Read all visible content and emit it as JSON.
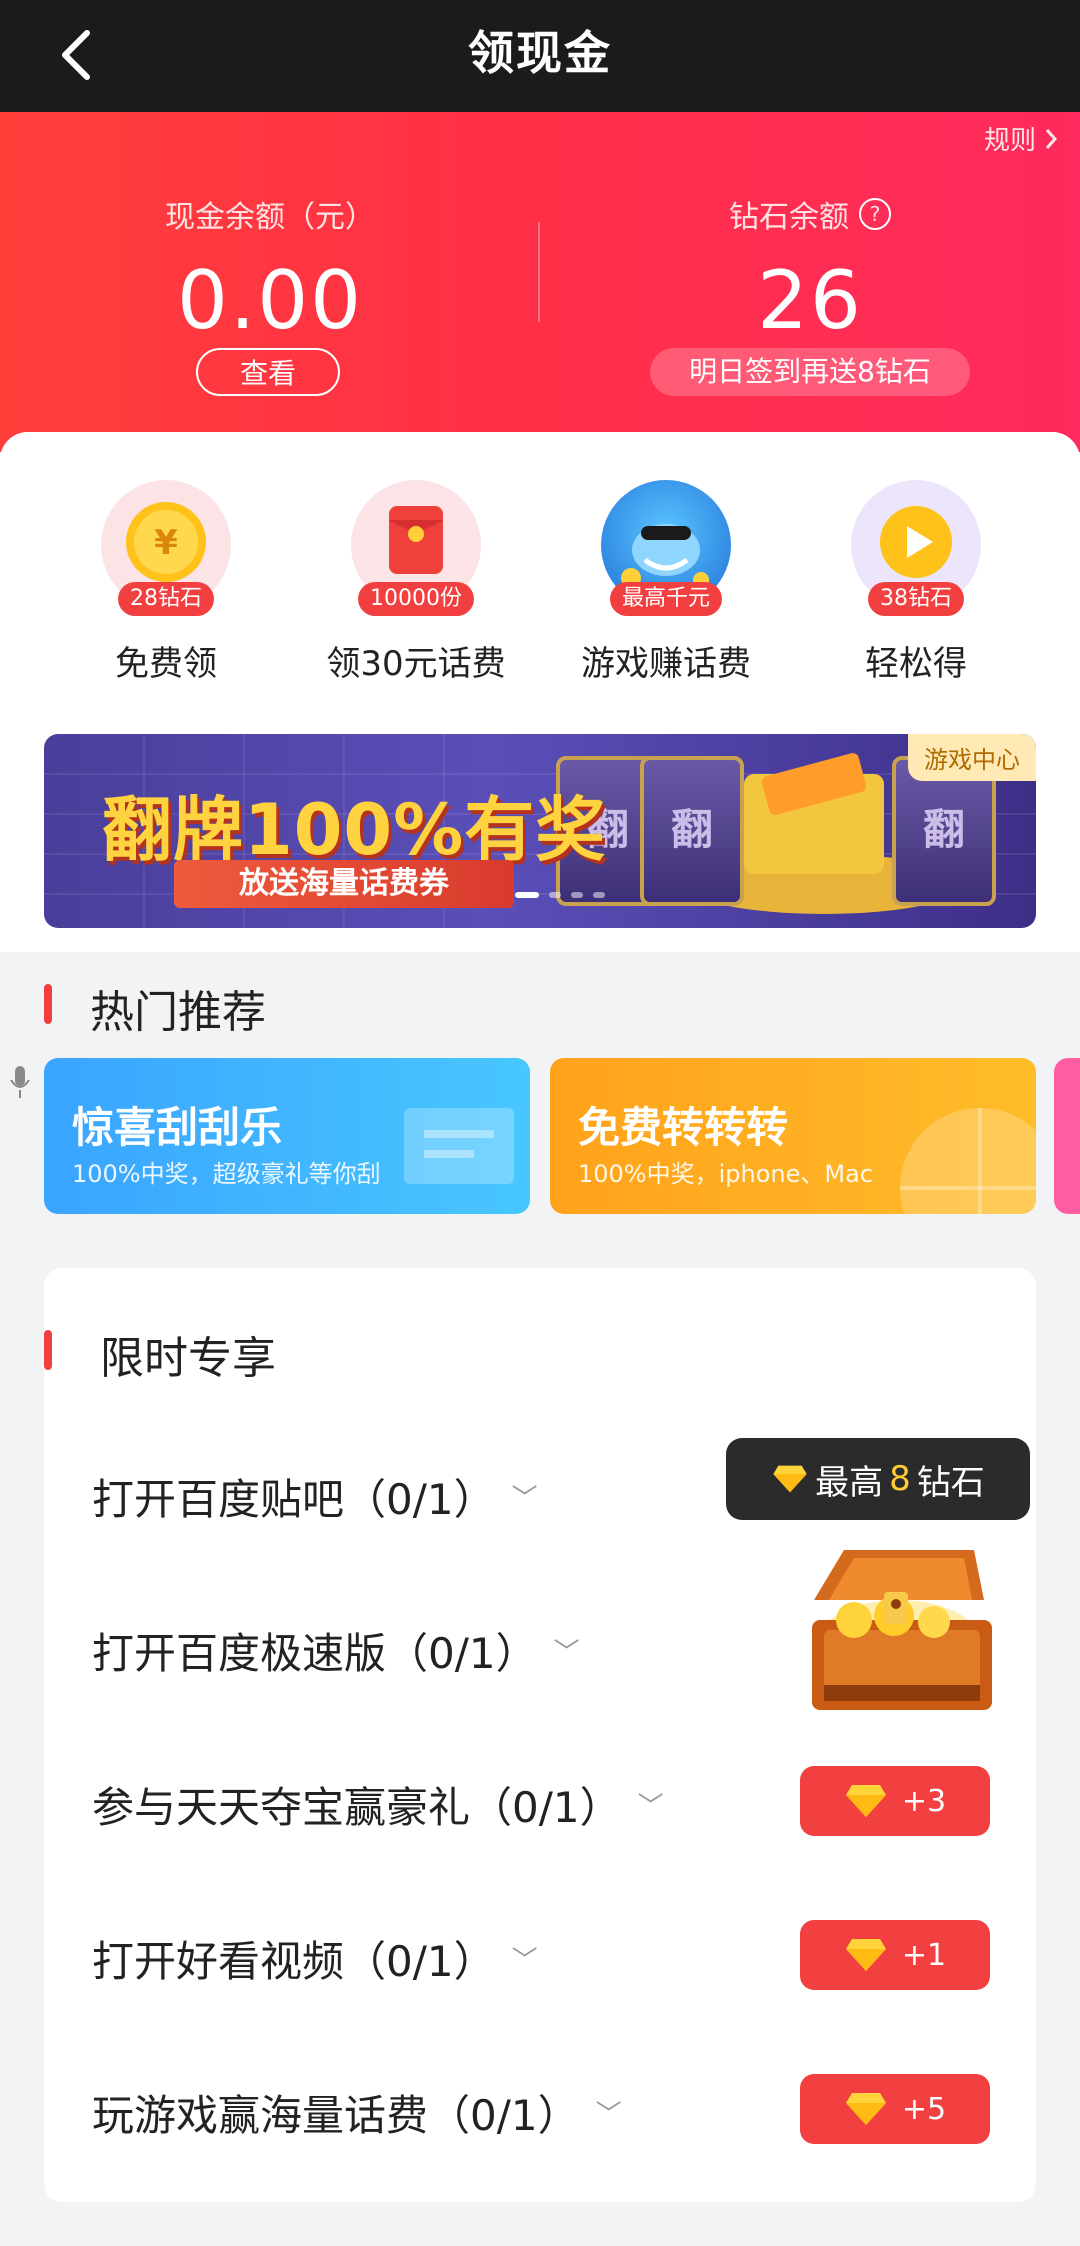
{
  "nav": {
    "title": "领现金"
  },
  "hero": {
    "rules": "规则",
    "cash_label": "现金余额（元）",
    "cash_value": "0.00",
    "view_label": "查看",
    "diamond_label": "钻石余额",
    "diamond_value": "26",
    "tomorrow_text": "明日签到再送8钻石"
  },
  "quick": [
    {
      "badge": "28钻石",
      "name": "免费领",
      "icon": "coin-icon"
    },
    {
      "badge": "10000份",
      "name": "领30元话费",
      "icon": "red-envelope-icon"
    },
    {
      "badge": "最高千元",
      "name": "游戏赚话费",
      "icon": "game-avatar-icon"
    },
    {
      "badge": "38钻石",
      "name": "轻松得",
      "icon": "play-icon"
    }
  ],
  "banner": {
    "tag": "游戏中心",
    "title": "翻牌100%有奖",
    "subtitle": "放送海量话费券",
    "card_char": "翻"
  },
  "hot": {
    "title": "热门推荐",
    "items": [
      {
        "title": "惊喜刮刮乐",
        "subtitle": "100%中奖，超级豪礼等你刮"
      },
      {
        "title": "免费转转转",
        "subtitle": "100%中奖，iphone、Mac"
      }
    ]
  },
  "limited": {
    "title": "限时专享",
    "tasks": [
      {
        "label": "打开百度贴吧（0/1）"
      },
      {
        "label": "打开百度极速版（0/1）"
      },
      {
        "label": "参与天天夺宝赢豪礼（0/1）",
        "reward": "+3"
      },
      {
        "label": "打开好看视频（0/1）",
        "reward": "+1"
      },
      {
        "label": "玩游戏赢海量话费（0/1）",
        "reward": "+5"
      }
    ],
    "tooltip_prefix": "最高",
    "tooltip_num": "8",
    "tooltip_suffix": "钻石"
  },
  "colors": {
    "accent": "#f24040",
    "hero_start": "#ff3e3a",
    "hero_end": "#ff2a5d"
  }
}
